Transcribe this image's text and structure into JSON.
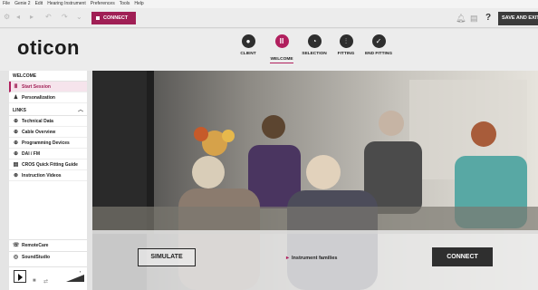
{
  "menu": [
    "File",
    "Genie 2",
    "Edit",
    "Hearing Instrument",
    "Preferences",
    "Tools",
    "Help"
  ],
  "toolbar": {
    "icons": [
      "settings-icon",
      "back-icon",
      "forward-icon",
      "undo-icon",
      "redo-icon"
    ],
    "connect_label": "CONNECT",
    "save_exit_label": "SAVE AND EXIT",
    "help_label": "?"
  },
  "brand": {
    "logo": "oticon",
    "accent": "#b11f5e"
  },
  "steps": [
    {
      "label": "CLIENT",
      "icon": "person-icon",
      "active": false
    },
    {
      "label": "WELCOME",
      "icon": "bars-icon",
      "active": true
    },
    {
      "label": "SELECTION",
      "icon": "ear-icon",
      "active": false
    },
    {
      "label": "FITTING",
      "icon": "sliders-icon",
      "active": false
    },
    {
      "label": "END FITTING",
      "icon": "check-icon",
      "active": false
    }
  ],
  "sidebar": {
    "welcome_heading": "WELCOME",
    "welcome_items": [
      {
        "label": "Start Session",
        "icon": "bars-icon",
        "active": true
      },
      {
        "label": "Personalization",
        "icon": "user-icon",
        "active": false
      }
    ],
    "links_heading": "LINKS",
    "links_items": [
      {
        "label": "Technical Data",
        "icon": "globe-icon"
      },
      {
        "label": "Cable Overview",
        "icon": "globe-icon"
      },
      {
        "label": "Programming Devices",
        "icon": "globe-icon"
      },
      {
        "label": "DAI / FM",
        "icon": "globe-icon"
      },
      {
        "label": "CROS Quick Fitting Guide",
        "icon": "document-icon"
      },
      {
        "label": "Instruction Videos",
        "icon": "play-circle-icon"
      }
    ],
    "remote_care": "RemoteCare",
    "sound_studio": "SoundStudio"
  },
  "hero": {
    "simulate_label": "SIMULATE",
    "families_label": "Instrument families",
    "connect_label": "CONNECT"
  }
}
